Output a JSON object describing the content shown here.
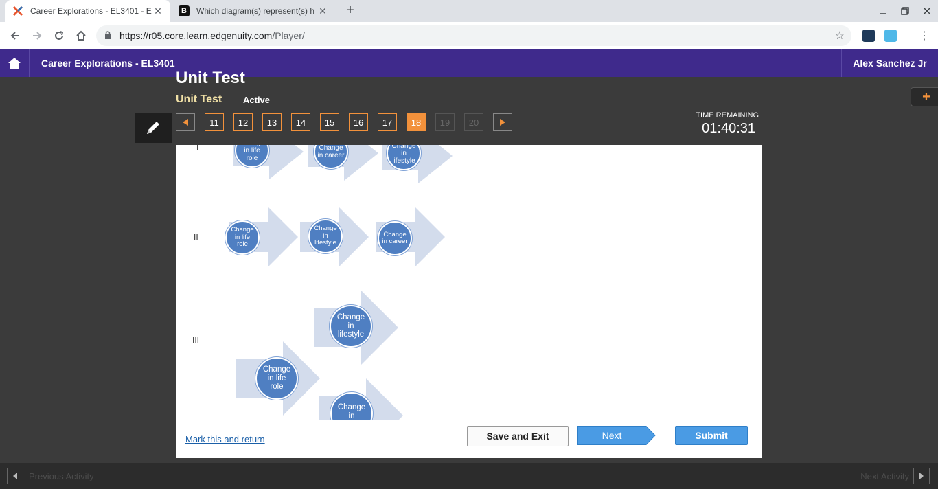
{
  "browser": {
    "tabs": [
      {
        "title": "Career Explorations - EL3401 - E",
        "active": true
      },
      {
        "title": "Which diagram(s) represent(s) h",
        "active": false
      }
    ],
    "url_host": "https://r05.core.learn.edgenuity.com",
    "url_path": "/Player/"
  },
  "header": {
    "course": "Career Explorations - EL3401",
    "user": "Alex Sanchez Jr"
  },
  "activity": {
    "title": "Unit Test",
    "subtitle": "Unit Test",
    "status": "Active",
    "questions": [
      {
        "num": "11",
        "state": "answered"
      },
      {
        "num": "12",
        "state": "answered"
      },
      {
        "num": "13",
        "state": "answered"
      },
      {
        "num": "14",
        "state": "answered"
      },
      {
        "num": "15",
        "state": "answered"
      },
      {
        "num": "16",
        "state": "answered"
      },
      {
        "num": "17",
        "state": "answered"
      },
      {
        "num": "18",
        "state": "current"
      },
      {
        "num": "19",
        "state": "disabled"
      },
      {
        "num": "20",
        "state": "disabled"
      }
    ],
    "time_label": "TIME REMAINING",
    "time_value": "01:40:31"
  },
  "diagrams": {
    "roman_1": "I",
    "roman_2": "II",
    "roman_3": "III",
    "d1": [
      "Change in life role",
      "Change in career",
      "Change in lifestyle"
    ],
    "d2": [
      "Change in life role",
      "Change in lifestyle",
      "Change in career"
    ],
    "d3": [
      "Change in lifestyle",
      "Change in life role",
      "Change in"
    ]
  },
  "footer": {
    "mark": "Mark this and return",
    "save": "Save and Exit",
    "next": "Next",
    "submit": "Submit"
  },
  "bottom": {
    "prev": "Previous Activity",
    "next": "Next Activity"
  },
  "colors": {
    "header_purple": "#3f2a8c",
    "accent_orange": "#f2913b",
    "circle_blue": "#4f7fc2",
    "arrow_light": "#d3dcec"
  }
}
